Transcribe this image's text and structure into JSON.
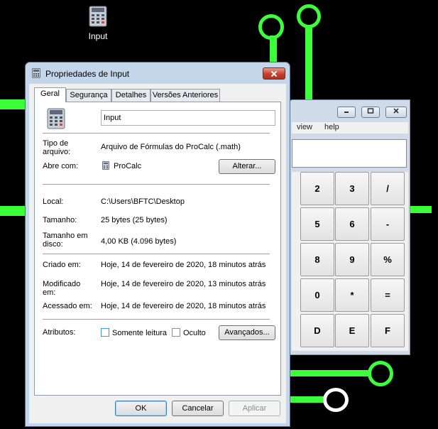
{
  "desktop": {
    "icon_label": "Input"
  },
  "calculator": {
    "menu": [
      "view",
      "help"
    ],
    "keys": [
      [
        "2",
        "3",
        "/"
      ],
      [
        "5",
        "6",
        "-"
      ],
      [
        "8",
        "9",
        "%"
      ],
      [
        "0",
        "*",
        "="
      ],
      [
        "D",
        "E",
        "F"
      ]
    ]
  },
  "dialog": {
    "title": "Propriedades de Input",
    "tabs": [
      "Geral",
      "Segurança",
      "Detalhes",
      "Versões Anteriores"
    ],
    "file_name": "Input",
    "type_label": "Tipo de arquivo:",
    "type_value": "Arquivo de Fórmulas do ProCalc (.math)",
    "opens_label": "Abre com:",
    "opens_value": "ProCalc",
    "change_button": "Alterar...",
    "location_label": "Local:",
    "location_value": "C:\\Users\\BFTC\\Desktop",
    "size_label": "Tamanho:",
    "size_value": "25 bytes (25 bytes)",
    "disk_size_label": "Tamanho em disco:",
    "disk_size_value": "4,00 KB (4.096 bytes)",
    "created_label": "Criado em:",
    "created_value": "Hoje, 14 de fevereiro de 2020, 18 minutos atrás",
    "modified_label": "Modificado em:",
    "modified_value": "Hoje, 14 de fevereiro de 2020, 13 minutos atrás",
    "accessed_label": "Acessado em:",
    "accessed_value": "Hoje, 14 de fevereiro de 2020, 18 minutos atrás",
    "attributes_label": "Atributos:",
    "readonly_label": "Somente leitura",
    "hidden_label": "Oculto",
    "advanced_button": "Avançados...",
    "ok_button": "OK",
    "cancel_button": "Cancelar",
    "apply_button": "Aplicar"
  },
  "colors": {
    "accent_green": "#3bff3b",
    "close_red": "#c2402c",
    "window_frame": "#c3d6ea"
  }
}
